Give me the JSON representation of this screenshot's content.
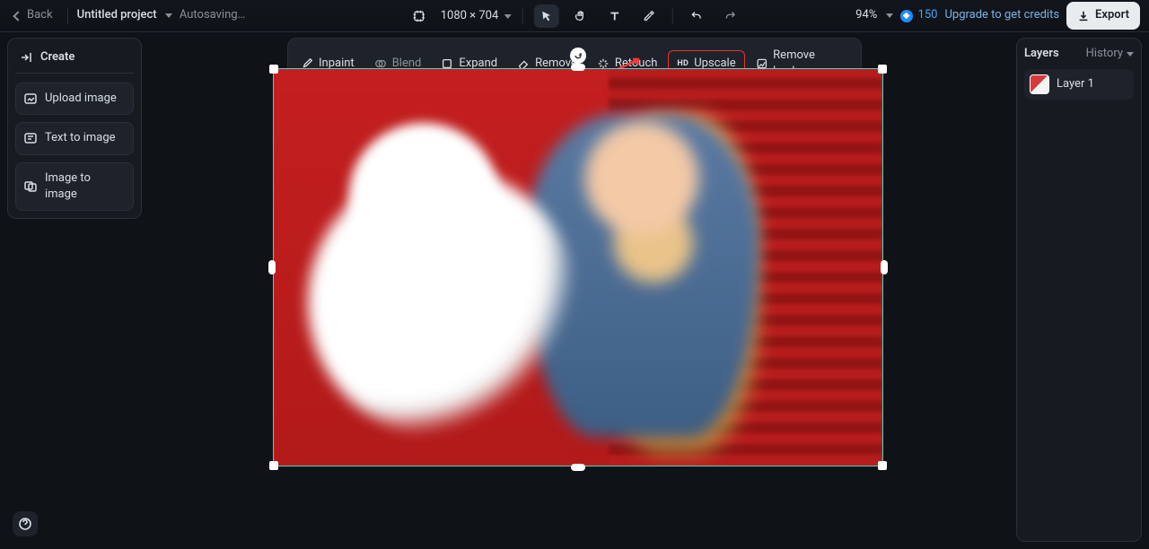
{
  "header": {
    "back": "Back",
    "project_name": "Untitled project",
    "status": "Autosaving…",
    "dimensions": "1080 × 704",
    "zoom": "94%",
    "credits": "150",
    "upgrade": "Upgrade to get credits",
    "export": "Export"
  },
  "tools": {
    "inpaint": "Inpaint",
    "blend": "Blend",
    "expand": "Expand",
    "remove": "Remove",
    "retouch": "Retouch",
    "upscale": "Upscale",
    "remove_bg": "Remove back…"
  },
  "left": {
    "create": "Create",
    "items": [
      {
        "label": "Upload image"
      },
      {
        "label": "Text to image"
      },
      {
        "label": "Image to image"
      }
    ]
  },
  "right": {
    "layers": "Layers",
    "history": "History",
    "layer1": "Layer 1"
  }
}
